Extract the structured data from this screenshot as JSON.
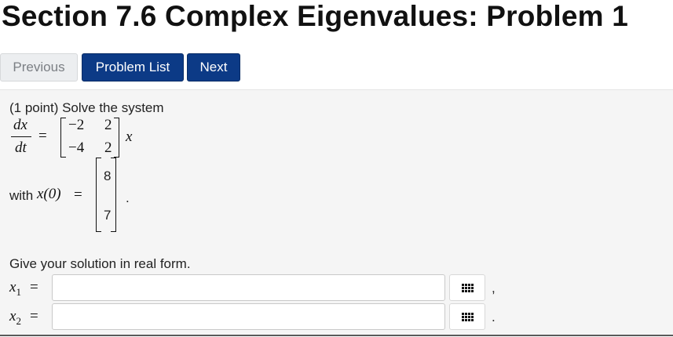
{
  "title": "Section 7.6 Complex Eigenvalues: Problem 1",
  "nav": {
    "previous": "Previous",
    "problem_list": "Problem List",
    "next": "Next"
  },
  "problem": {
    "intro": "(1 point) Solve the system",
    "lhs_num": "dx",
    "lhs_den": "dt",
    "equals": "=",
    "matrix": [
      [
        "−2",
        "2"
      ],
      [
        "−4",
        "2"
      ]
    ],
    "var": "x",
    "with_label": "with ",
    "initial_lhs": "x(0)",
    "initial_vector": [
      "8",
      "7"
    ],
    "period": ".",
    "instruction": "Give your solution in real form.",
    "answers": [
      {
        "label": "x",
        "sub": "1",
        "eq": "=",
        "value": "",
        "trail": ","
      },
      {
        "label": "x",
        "sub": "2",
        "eq": "=",
        "value": "",
        "trail": "."
      }
    ]
  }
}
